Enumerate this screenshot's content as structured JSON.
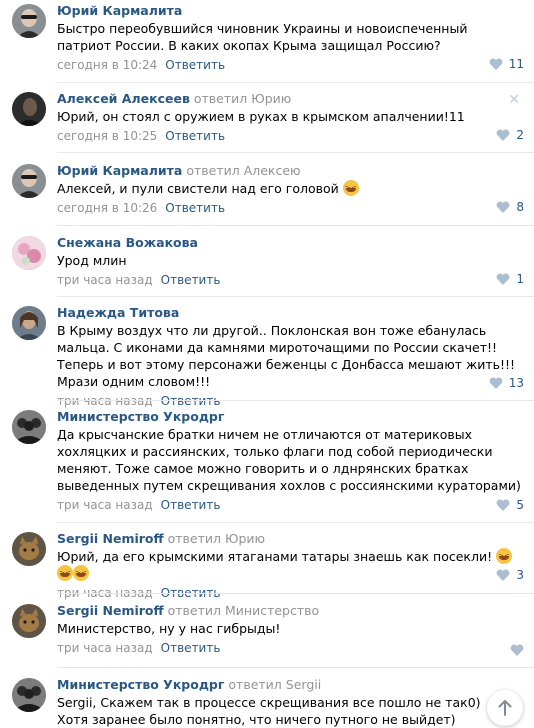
{
  "comments": [
    {
      "author": "Юрий Кармалита",
      "replied_label": "",
      "reply_to": "",
      "text": "Быстро переобувшийся чиновник Украины и новоиспеченный патриот России. В каких окопах Крыма защищал Россию?",
      "time": "сегодня в 10:24",
      "reply_label": "Ответить",
      "likes": "11",
      "avatar": "man-in-sunglasses"
    },
    {
      "author": "Алексей Алексеев",
      "replied_label": "ответил",
      "reply_to": "Юрию",
      "text": "Юрий, он стоял с оружием в руках в крымском апалчении!11",
      "time": "сегодня в 10:25",
      "reply_label": "Ответить",
      "likes": "2",
      "avatar": "dark-portrait"
    },
    {
      "author": "Юрий Кармалита",
      "replied_label": "ответил",
      "reply_to": "Алексею",
      "text": "Алексей, и пули свистели над его головой",
      "time": "сегодня в 10:26",
      "reply_label": "Ответить",
      "likes": "8",
      "avatar": "man-in-sunglasses"
    },
    {
      "author": "Снежана Вожакова",
      "replied_label": "",
      "reply_to": "",
      "text": "Урод млин",
      "time": "три часа назад",
      "reply_label": "Ответить",
      "likes": "1",
      "avatar": "pink-floral"
    },
    {
      "author": "Надежда Титова",
      "replied_label": "",
      "reply_to": "",
      "text": "В Крыму воздух что ли другой.. Поклонская вон тоже ебанулась мальца. С иконами да камнями мироточащими по России скачет!! Теперь и вот этому персонажи беженцы с Донбасса мешают жить!!! Мрази одним словом!!!",
      "time": "три часа назад",
      "reply_label": "Ответить",
      "likes": "13",
      "avatar": "woman-portrait"
    },
    {
      "author": "Министерство Укродрг",
      "replied_label": "",
      "reply_to": "",
      "text": "Да крысчанские братки ничем не отличаются от материковых хохляцких и рассиянских, только флаги под собой периодически меняют. Тоже самое можно говорить и о лднрянских братках выведенных путем скрещивания хохлов с россиянскими кураторами)",
      "time": "три часа назад",
      "reply_label": "Ответить",
      "likes": "5",
      "avatar": "group-of-men"
    },
    {
      "author": "Sergii Nemiroff",
      "replied_label": "ответил",
      "reply_to": "Юрию",
      "text": "Юрий, да его крымскими ятаганами татары знаешь как посекли!",
      "time": "три часа назад",
      "reply_label": "Ответить",
      "likes": "3",
      "avatar": "cat-photo"
    },
    {
      "author": "Sergii Nemiroff",
      "replied_label": "ответил",
      "reply_to": "Министерство",
      "text": "Министерство, ну у нас гибрыды!",
      "time": "три часа назад",
      "reply_label": "Ответить",
      "likes": "",
      "avatar": "cat-photo"
    },
    {
      "author": "Министерство Укродрг",
      "replied_label": "ответил",
      "reply_to": "Sergii",
      "text": "Sergii, Скажем так в процессе скрещивания все пошло не так0) Хотя заранее было понятно, что ничего путного не выйдет)",
      "time": "",
      "reply_label": "",
      "likes": "",
      "avatar": "group-of-men"
    }
  ],
  "colors": {
    "link": "#2a5885",
    "muted": "#939393",
    "divider": "#e7e8ec"
  },
  "icons": {
    "like": "heart-icon",
    "close": "close-icon",
    "scroll": "arrow-up-icon"
  }
}
